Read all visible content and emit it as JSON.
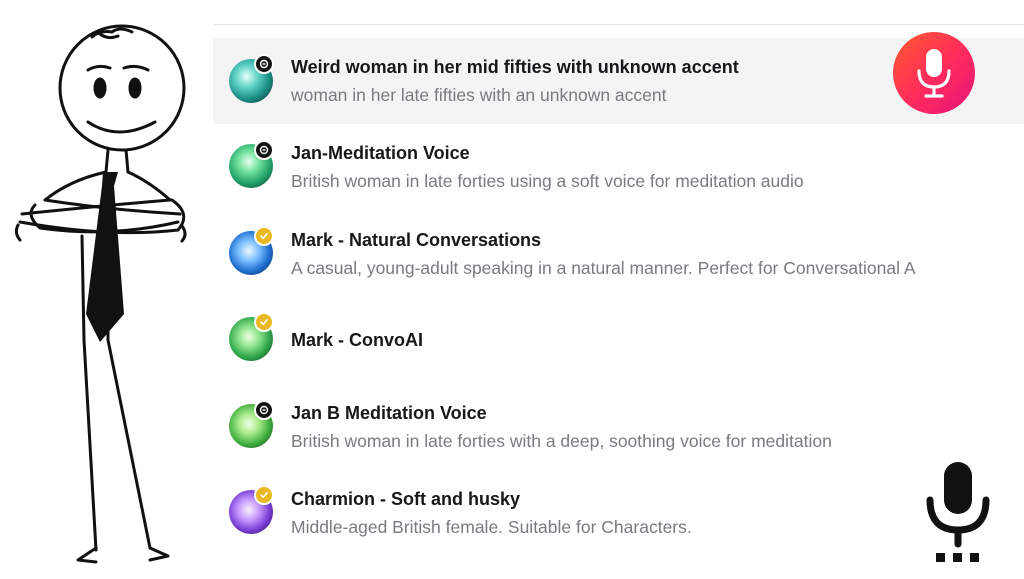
{
  "voices": [
    {
      "name": "Weird woman in her mid fifties with unknown accent",
      "description": "woman in her late fifties with an unknown accent",
      "badge": "cloned",
      "selected": true
    },
    {
      "name": "Jan-Meditation Voice",
      "description": "British woman in late forties using a soft voice for meditation audio",
      "badge": "cloned",
      "selected": false
    },
    {
      "name": "Mark - Natural Conversations",
      "description": "A casual, young-adult speaking in a natural manner. Perfect for Conversational A",
      "badge": "verified",
      "selected": false
    },
    {
      "name": "Mark - ConvoAI",
      "description": "",
      "badge": "verified",
      "selected": false
    },
    {
      "name": "Jan B Meditation Voice",
      "description": "British woman in late forties with a deep, soothing voice for meditation",
      "badge": "cloned",
      "selected": false
    },
    {
      "name": "Charmion - Soft and husky",
      "description": "Middle-aged British female. Suitable for Characters.",
      "badge": "verified",
      "selected": false
    }
  ],
  "icons": {
    "record": "microphone-icon",
    "decoration": "microphone-icon",
    "figure": "stick-figure-illustration"
  },
  "colors": {
    "mic_gradient": [
      "#ff5a2c",
      "#ff2a5e",
      "#e4157a"
    ],
    "verified_badge": "#e8b923",
    "cloned_badge": "#141414",
    "selected_row": "#f4f4f5"
  }
}
